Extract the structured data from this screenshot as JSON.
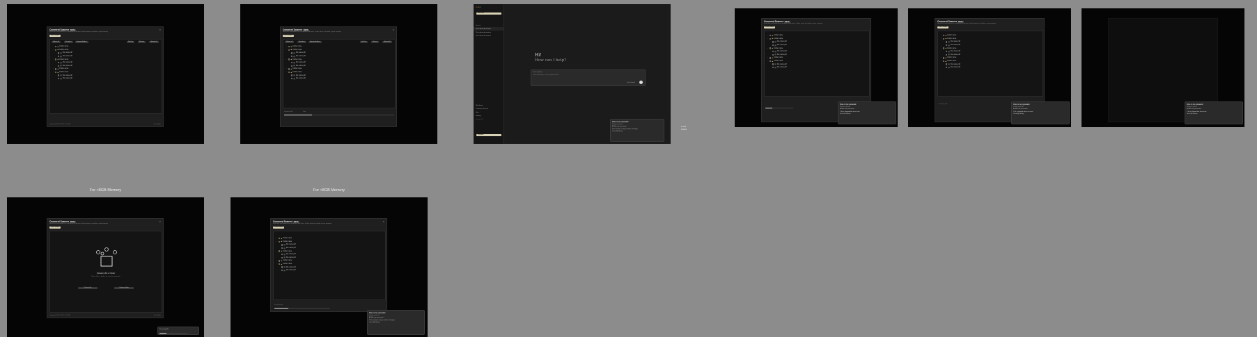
{
  "canvas": {
    "background": "#8c8c8c"
  },
  "captions": {
    "bottom_left": "For <8GB Memory",
    "bottom_mid": "For <8GB Memory"
  },
  "scanner": {
    "title": "Comment Scanner",
    "badge": "BETA",
    "subtitle": "Scan files and folders for comments and notes. Select items to include in your memory.",
    "local_folder": "Local Folder",
    "buttons": {
      "select_all": "Select all",
      "deselect": "Deselect",
      "expand": "Expand folders",
      "sort": "Sort by",
      "recent": "Recent",
      "upload": "Upload all"
    },
    "tree": [
      {
        "label": "Folder name",
        "icon": "folder",
        "depth": 0
      },
      {
        "label": "Folder name",
        "icon": "folder",
        "depth": 0
      },
      {
        "label": "File name.pdf",
        "icon": "file",
        "depth": 1
      },
      {
        "label": "File name.pdf",
        "icon": "file",
        "depth": 1
      },
      {
        "label": "Folder name",
        "icon": "folder",
        "depth": 0
      },
      {
        "label": "File name.pdf",
        "icon": "file",
        "depth": 1
      },
      {
        "label": "File name.pdf",
        "icon": "file",
        "depth": 1
      },
      {
        "label": "Folder name",
        "icon": "folder",
        "depth": 0
      },
      {
        "label": "Folder name",
        "icon": "folder",
        "depth": 0
      },
      {
        "label": "File name.pdf",
        "icon": "file",
        "depth": 1
      },
      {
        "label": "File name.pdf",
        "icon": "file",
        "depth": 1
      }
    ],
    "footer_left": "Supported: PDF, DOCX, TXT, MD",
    "footer_right": "Scan folder",
    "scanning_label": "Scanning files",
    "stop": "Stop",
    "progress": 0.25,
    "empty_title": "Upload a file or folder",
    "empty_sub": "Select files or folders to scan for comments",
    "empty_btn1": "Choose file",
    "empty_btn2": "Choose folder",
    "scan_status": "Scanning files"
  },
  "toasts": {
    "scan_complete": {
      "title": "Files to be uploaded",
      "sub": "Ready to upload",
      "items": [
        "All files are processed",
        "1 file contains a large number of images",
        "Go to My Library"
      ]
    },
    "scan_done": {
      "title": "Files to be uploaded",
      "sub": "Ready to upload",
      "items": [
        "All files are processed",
        "1 file is skipped due to an error",
        "Go to My Library"
      ]
    },
    "scan_failed": {
      "title": "Files to be uploaded",
      "sub": "Ready to upload",
      "items": [
        "All files are processed",
        "1 file is skipped due to an error",
        "Go to My Library"
      ]
    },
    "upload_complete": {
      "title": "Files to be uploaded",
      "sub": "Ready to upload",
      "items": [
        "All files are processed",
        "1 file is skipped due to an error",
        "Go to My Library"
      ]
    }
  },
  "chat": {
    "new_chat": "New chat",
    "recents_label": "Recent",
    "recents": [
      "Chat about documents",
      "Chat about documents",
      "Chat about documents"
    ],
    "greeting": "Hi!",
    "help": "How can I help?",
    "input_label": "Ask anything",
    "input_placeholder": "Ask anything or use the upload button",
    "model": "Local model",
    "menu": [
      "My Library",
      "Comment Scanner",
      "Help",
      "Settings"
    ],
    "footer_note": "Version 1.0",
    "upgrade": "Upgrade",
    "legend": [
      "Local",
      "Cloud"
    ]
  }
}
